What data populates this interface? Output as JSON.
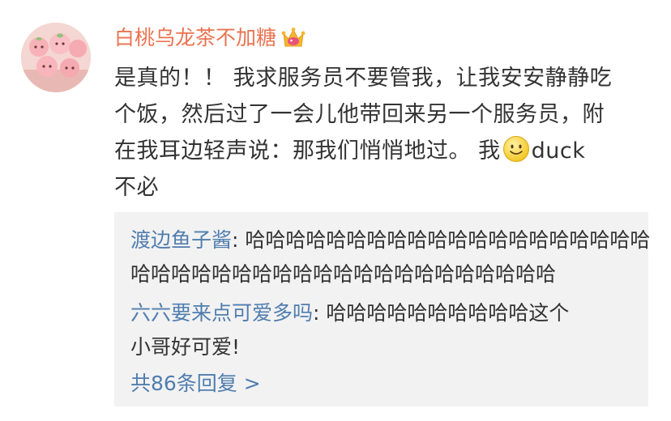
{
  "comment": {
    "username": "白桃乌龙茶不加糖",
    "badge_icon": "crown-vip-icon",
    "text_lines": [
      "是真的！！ 我求服务员不要管我，让我安安静静吃",
      "个饭，然后过了一会儿他带回来另一个服务员，附",
      "在我耳边轻声说：那我们悄悄地过。  我",
      "duck",
      "不必"
    ],
    "emoji": "smile-emoji"
  },
  "replies": [
    {
      "user": "渡边鱼子酱",
      "separator": ": ",
      "text_line1": "哈哈哈哈哈哈哈哈哈哈哈哈哈哈哈哈哈哈哈哈",
      "text_line2": "哈哈哈哈哈哈哈哈哈哈哈哈哈哈哈哈哈哈哈哈哈"
    },
    {
      "user": "六六要来点可爱多吗",
      "separator": ": ",
      "text_line1": "哈哈哈哈哈哈哈哈哈哈这个",
      "text_line2": "小哥好可爱!"
    }
  ],
  "more_replies": "共86条回复 >",
  "colors": {
    "username": "#eb7350",
    "link": "#507daf",
    "text": "#333333",
    "reply_bg": "#f2f2f2"
  }
}
